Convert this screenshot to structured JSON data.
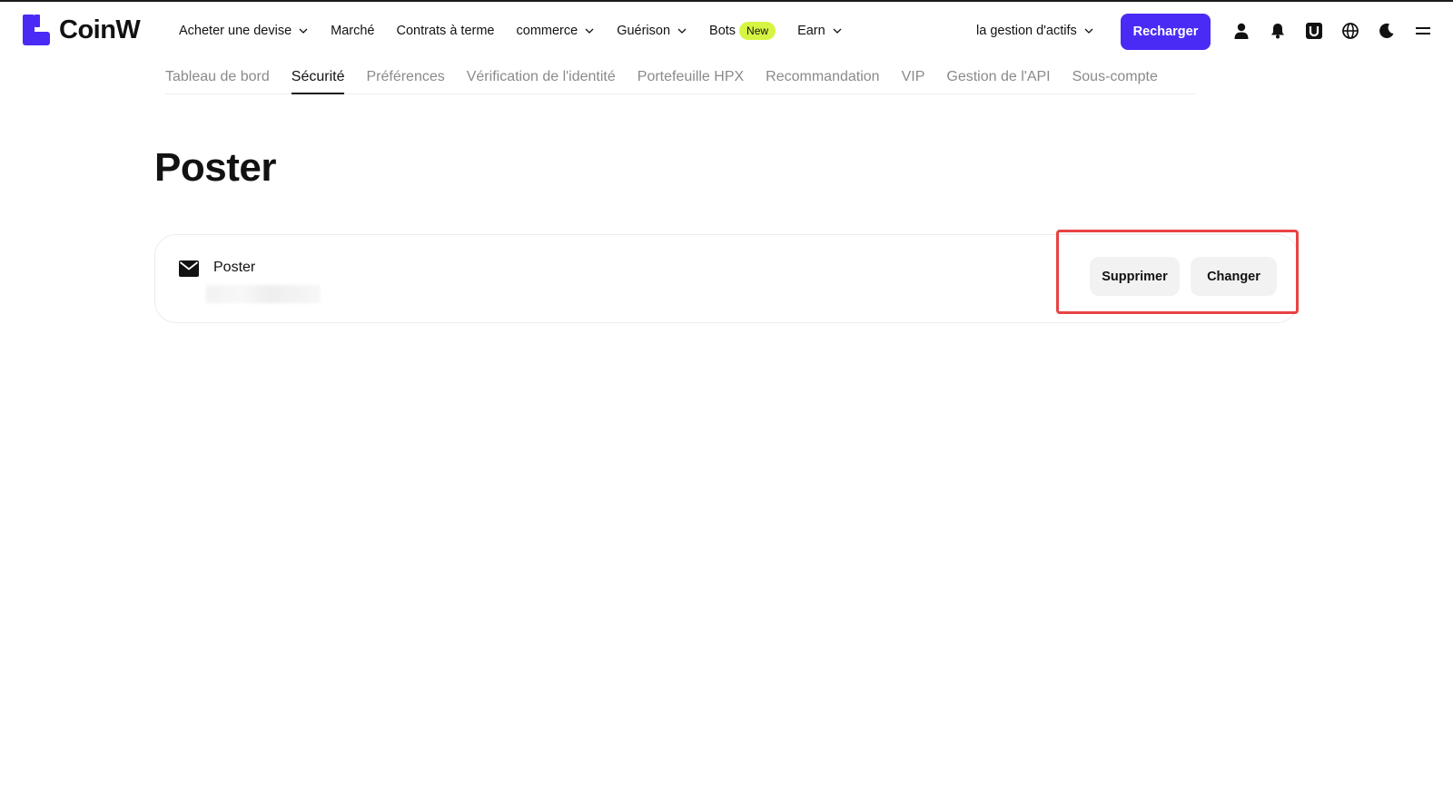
{
  "brand": {
    "name": "CoinW",
    "color": "#4a2bf5"
  },
  "nav": {
    "items": [
      {
        "label": "Acheter une devise",
        "dropdown": true
      },
      {
        "label": "Marché",
        "dropdown": false
      },
      {
        "label": "Contrats à terme",
        "dropdown": false
      },
      {
        "label": "commerce",
        "dropdown": true
      },
      {
        "label": "Guérison",
        "dropdown": true
      },
      {
        "label": "Bots",
        "dropdown": false,
        "badge": "New"
      },
      {
        "label": "Earn",
        "dropdown": true
      }
    ],
    "asset_management": "la gestion d'actifs",
    "recharge": "Recharger",
    "tools": [
      "user-icon",
      "bell-icon",
      "download-icon",
      "globe-icon",
      "moon-icon",
      "menu-icon"
    ]
  },
  "tabs": [
    {
      "label": "Tableau de bord",
      "active": false
    },
    {
      "label": "Sécurité",
      "active": true
    },
    {
      "label": "Préférences",
      "active": false
    },
    {
      "label": "Vérification de l'identité",
      "active": false
    },
    {
      "label": "Portefeuille HPX",
      "active": false
    },
    {
      "label": "Recommandation",
      "active": false
    },
    {
      "label": "VIP",
      "active": false
    },
    {
      "label": "Gestion de l'API",
      "active": false
    },
    {
      "label": "Sous-compte",
      "active": false
    }
  ],
  "page": {
    "title": "Poster",
    "card": {
      "label": "Poster",
      "icon": "mail-icon",
      "delete_label": "Supprimer",
      "change_label": "Changer"
    },
    "highlight_color": "#e84343"
  },
  "colors": {
    "badge": "#d6f542",
    "button_bg": "#f2f2f2"
  }
}
